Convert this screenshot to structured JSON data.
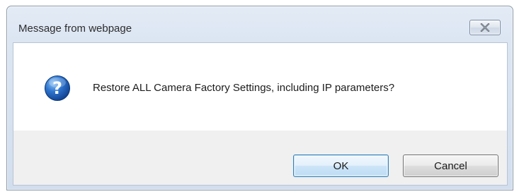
{
  "dialog": {
    "title": "Message from webpage",
    "message": "Restore ALL Camera Factory Settings, including IP parameters?",
    "icon": "question-icon",
    "close_icon": "close-icon",
    "buttons": {
      "ok_label": "OK",
      "cancel_label": "Cancel"
    }
  },
  "colors": {
    "title_bar": "#dce6f3",
    "content_background": "#ffffff",
    "footer_background": "#f0f0f0",
    "question_icon": "#1f5fb8",
    "default_button_border": "#3c7fb1"
  }
}
